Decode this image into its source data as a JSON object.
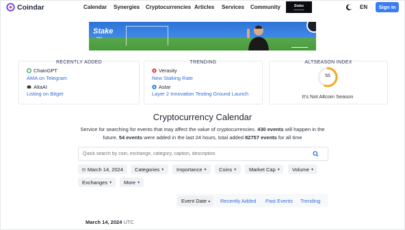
{
  "brand": {
    "name": "Coindar"
  },
  "nav": [
    {
      "label": "Calendar"
    },
    {
      "label": "Synergies"
    },
    {
      "label": "Cryptocurrencies"
    },
    {
      "label": "Articles"
    },
    {
      "label": "Services"
    },
    {
      "label": "Community"
    }
  ],
  "header": {
    "language": "EN",
    "signin_label": "Sign In",
    "ad_logo_text": "Stake"
  },
  "banner": {
    "brand": "Stake",
    "brand_suffix": ".com"
  },
  "recently_added": {
    "title": "RECENTLY ADDED",
    "items": [
      {
        "coin": "ChainGPT",
        "event": "AMA on Telegram"
      },
      {
        "coin": "AltaAI",
        "event": "Listing on Bitget"
      }
    ]
  },
  "trending": {
    "title": "TRENDING",
    "items": [
      {
        "coin": "Verasity",
        "event": "New Staking Rate"
      },
      {
        "coin": "Astar",
        "event": "Layer 2 Innovation Testing Ground Launch"
      }
    ]
  },
  "altseason": {
    "title": "ALTSEASON INDEX",
    "value": "55",
    "fraction": 0.55,
    "caption": "It's Not Altcoin Season"
  },
  "main": {
    "title": "Cryptocurrency Calendar",
    "desc_1": "Service for searching for events that may affect the value of cryptocurrencies. ",
    "events_total": "430 events",
    "desc_2": " will happen in the future, ",
    "events_added": "54 events",
    "desc_3": " were added in the last 24 hours, total added ",
    "events_all": "82757 events",
    "desc_4": " for all time"
  },
  "search": {
    "placeholder": "Quick search by coin, exchange, category, caption, description"
  },
  "filters": {
    "date": "March 14, 2024",
    "categories": "Categories",
    "importance": "Importance",
    "coins": "Coins",
    "market_cap": "Market Cap",
    "volume": "Volume",
    "exchanges": "Exchanges",
    "more": "More"
  },
  "sort": {
    "event_date": "Event Date",
    "recently_added": "Recently Added",
    "past_events": "Past Events",
    "trending": "Trending"
  },
  "list": {
    "date": "March 14, 2024",
    "tz": "UTC"
  },
  "colors": {
    "accent": "#3a7df2",
    "link": "#2f6bd6",
    "gauge": "#f5a623"
  }
}
